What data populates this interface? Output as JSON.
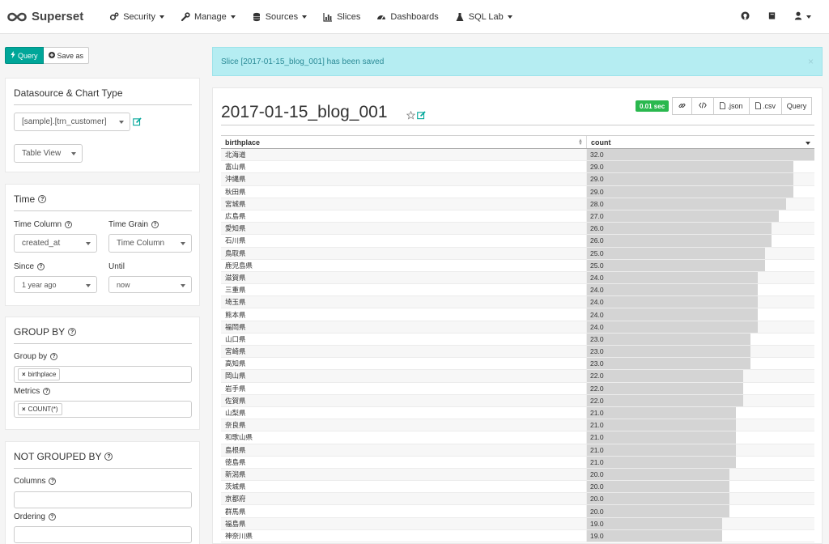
{
  "navbar": {
    "brand": "Superset",
    "items": [
      {
        "label": "Security",
        "icon": "cogs-icon",
        "dropdown": true
      },
      {
        "label": "Manage",
        "icon": "wrench-icon",
        "dropdown": true
      },
      {
        "label": "Sources",
        "icon": "database-icon",
        "dropdown": true
      },
      {
        "label": "Slices",
        "icon": "bar-chart-icon",
        "dropdown": false
      },
      {
        "label": "Dashboards",
        "icon": "dashboard-icon",
        "dropdown": false
      },
      {
        "label": "SQL Lab",
        "icon": "flask-icon",
        "dropdown": true
      }
    ],
    "right_icons": [
      "github-icon",
      "book-icon",
      "user-icon"
    ]
  },
  "toolbar": {
    "query_label": "Query",
    "save_as_label": "Save as"
  },
  "datasource_section": {
    "title": "Datasource & Chart Type",
    "datasource_value": "[sample].[trn_customer]",
    "chart_type_value": "Table View"
  },
  "time_section": {
    "title": "Time",
    "time_column_label": "Time Column",
    "time_column_value": "created_at",
    "time_grain_label": "Time Grain",
    "time_grain_value": "Time Column",
    "since_label": "Since",
    "since_value": "1 year ago",
    "until_label": "Until",
    "until_value": "now"
  },
  "groupby_section": {
    "title": "GROUP BY",
    "group_by_label": "Group by",
    "group_by_tag": "birthplace",
    "metrics_label": "Metrics",
    "metrics_tag": "COUNT(*)"
  },
  "not_grouped_section": {
    "title": "NOT GROUPED BY",
    "columns_label": "Columns",
    "ordering_label": "Ordering"
  },
  "alert": {
    "message": "Slice [2017-01-15_blog_001] has been saved",
    "close": "×"
  },
  "slice": {
    "title": "2017-01-15_blog_001",
    "timer": "0.01 sec",
    "buttons": {
      "json": ".json",
      "csv": ".csv",
      "query": "Query"
    }
  },
  "table": {
    "headers": [
      "birthplace",
      "count"
    ],
    "max_value": 32,
    "rows": [
      {
        "place": "北海道",
        "count": "32.0",
        "value": 32
      },
      {
        "place": "富山県",
        "count": "29.0",
        "value": 29
      },
      {
        "place": "沖縄県",
        "count": "29.0",
        "value": 29
      },
      {
        "place": "秋田県",
        "count": "29.0",
        "value": 29
      },
      {
        "place": "宮城県",
        "count": "28.0",
        "value": 28
      },
      {
        "place": "広島県",
        "count": "27.0",
        "value": 27
      },
      {
        "place": "愛知県",
        "count": "26.0",
        "value": 26
      },
      {
        "place": "石川県",
        "count": "26.0",
        "value": 26
      },
      {
        "place": "鳥取県",
        "count": "25.0",
        "value": 25
      },
      {
        "place": "鹿児島県",
        "count": "25.0",
        "value": 25
      },
      {
        "place": "滋賀県",
        "count": "24.0",
        "value": 24
      },
      {
        "place": "三重県",
        "count": "24.0",
        "value": 24
      },
      {
        "place": "埼玉県",
        "count": "24.0",
        "value": 24
      },
      {
        "place": "熊本県",
        "count": "24.0",
        "value": 24
      },
      {
        "place": "福岡県",
        "count": "24.0",
        "value": 24
      },
      {
        "place": "山口県",
        "count": "23.0",
        "value": 23
      },
      {
        "place": "宮崎県",
        "count": "23.0",
        "value": 23
      },
      {
        "place": "高知県",
        "count": "23.0",
        "value": 23
      },
      {
        "place": "岡山県",
        "count": "22.0",
        "value": 22
      },
      {
        "place": "岩手県",
        "count": "22.0",
        "value": 22
      },
      {
        "place": "佐賀県",
        "count": "22.0",
        "value": 22
      },
      {
        "place": "山梨県",
        "count": "21.0",
        "value": 21
      },
      {
        "place": "奈良県",
        "count": "21.0",
        "value": 21
      },
      {
        "place": "和歌山県",
        "count": "21.0",
        "value": 21
      },
      {
        "place": "島根県",
        "count": "21.0",
        "value": 21
      },
      {
        "place": "徳島県",
        "count": "21.0",
        "value": 21
      },
      {
        "place": "新潟県",
        "count": "20.0",
        "value": 20
      },
      {
        "place": "茨城県",
        "count": "20.0",
        "value": 20
      },
      {
        "place": "京都府",
        "count": "20.0",
        "value": 20
      },
      {
        "place": "群馬県",
        "count": "20.0",
        "value": 20
      },
      {
        "place": "福島県",
        "count": "19.0",
        "value": 19
      },
      {
        "place": "神奈川県",
        "count": "19.0",
        "value": 19
      }
    ]
  },
  "colors": {
    "accent": "#00a699",
    "timer": "#2ab84e",
    "alert_bg": "#b5edf2",
    "bar": "#d4d4d4"
  }
}
